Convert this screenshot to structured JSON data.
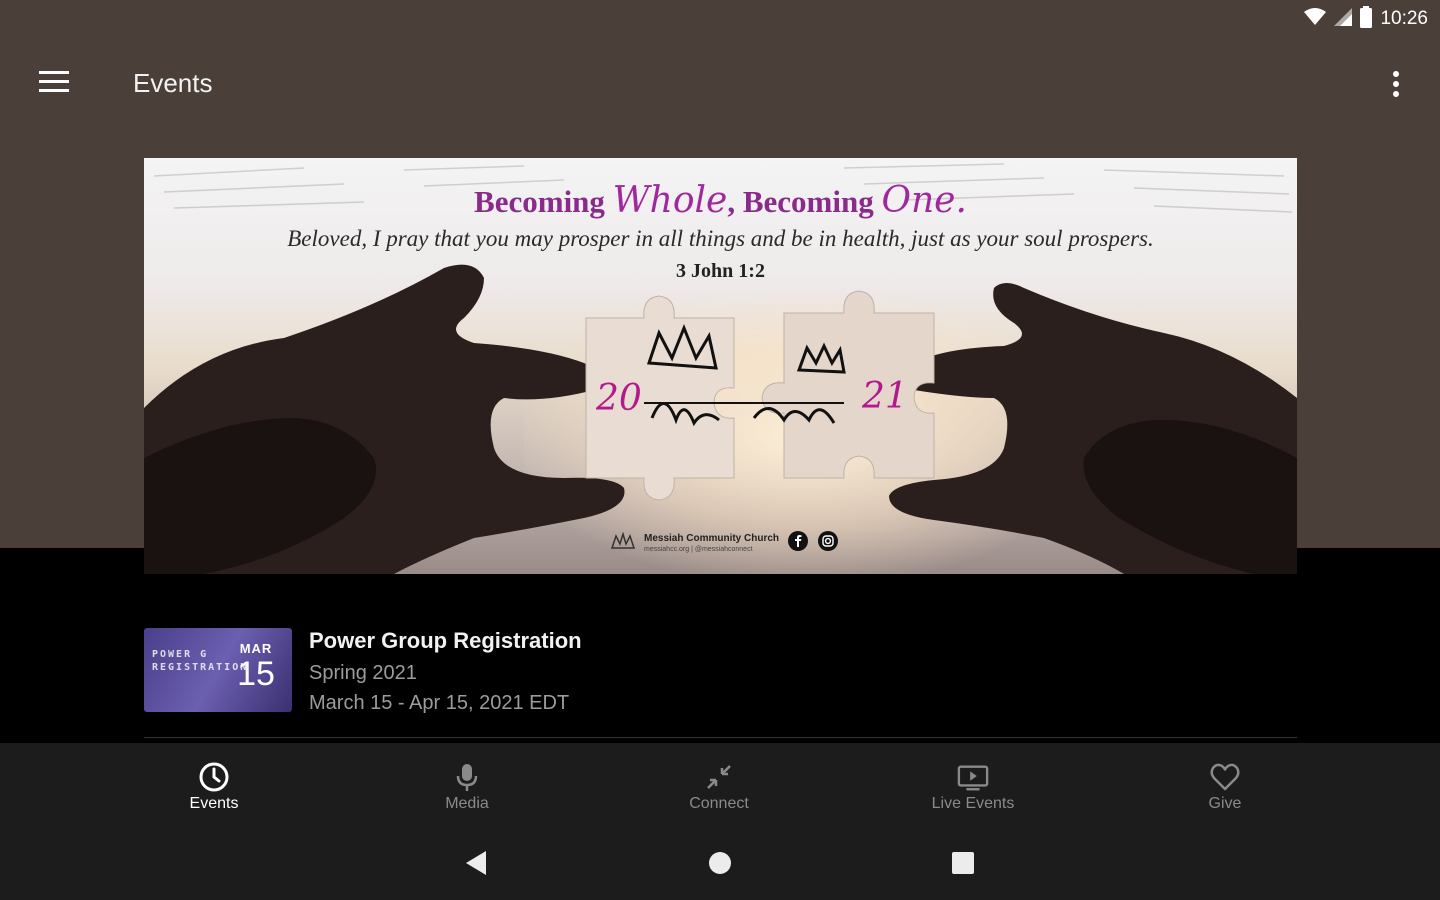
{
  "status_bar": {
    "time": "10:26"
  },
  "toolbar": {
    "title": "Events",
    "menu_icon": "hamburger-menu-icon",
    "overflow_icon": "more-vert-icon"
  },
  "banner": {
    "title_pre": "Becoming ",
    "title_script1": "Whole",
    "title_mid": ", Becoming ",
    "title_script2": "One.",
    "verse": "Beloved, I pray that you may prosper in all things and be in health, just as your soul prospers.",
    "reference": "3 John 1:2",
    "year_left": "20",
    "year_right": "21",
    "logo_text": "Messiah",
    "org_name": "Messiah Community Church",
    "org_sub": "messiahcc.org | @messiahconnect"
  },
  "events": [
    {
      "title": "Power Group Registration",
      "subtitle": "Spring 2021",
      "date_range": "March 15 - Apr 15, 2021 EDT",
      "thumb_text_1": "POWER G",
      "thumb_text_2": "REGISTRATION",
      "date_month": "MAR",
      "date_day": "15"
    }
  ],
  "bottom_nav": {
    "items": [
      {
        "label": "Events",
        "icon": "clock-icon",
        "active": true
      },
      {
        "label": "Media",
        "icon": "microphone-icon",
        "active": false
      },
      {
        "label": "Connect",
        "icon": "connect-arrows-icon",
        "active": false
      },
      {
        "label": "Live Events",
        "icon": "tv-play-icon",
        "active": false
      },
      {
        "label": "Give",
        "icon": "heart-icon",
        "active": false
      }
    ]
  },
  "colors": {
    "header_bg": "#4a3f39",
    "page_bg": "#000000",
    "nav_bg": "#1c1c1c",
    "accent_purple": "#8a2b8c"
  }
}
